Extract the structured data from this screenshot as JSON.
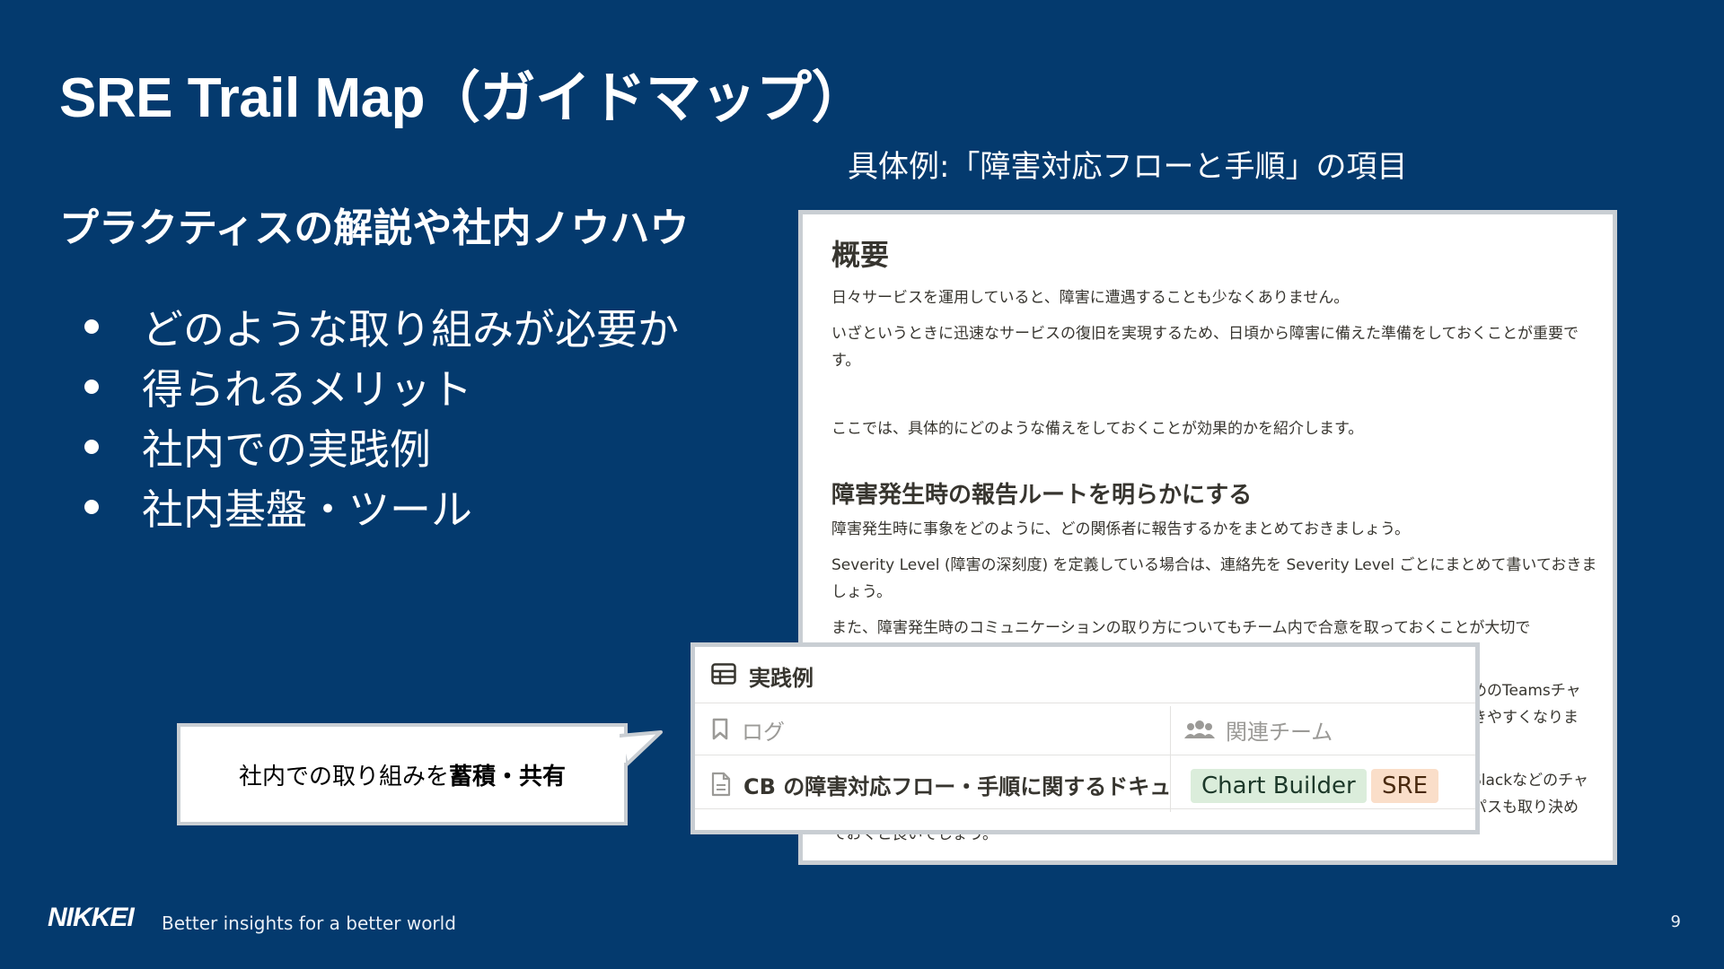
{
  "slide": {
    "title": "SRE Trail Map（ガイドマップ）",
    "subtitle": "プラクティスの解説や社内ノウハウ",
    "bullets": [
      "どのような取り組みが必要か",
      "得られるメリット",
      "社内での実践例",
      "社内基盤・ツール"
    ],
    "example_caption": "具体例:「障害対応フローと手順」の項目"
  },
  "doc": {
    "heading": "概要",
    "para1": "日々サービスを運用していると、障害に遭遇することも少なくありません。",
    "para2": "いざというときに迅速なサービスの復旧を実現するため、日頃から障害に備えた準備をしておくことが重要です。",
    "para3": "ここでは、具体的にどのような備えをしておくことが効果的かを紹介します。",
    "section_heading": "障害発生時の報告ルートを明らかにする",
    "para4": "障害発生時に事象をどのように、どの関係者に報告するかをまとめておきましょう。",
    "para5": "Severity Level (障害の深刻度) を定義している場合は、連絡先を Severity Level ごとにまとめて書いておきましょう。",
    "para6": "また、障害発生時のコミュニケーションの取り方についてもチーム内で合意を取っておくことが大切で",
    "frag1": "めのTeamsチャ",
    "frag2": "きやすくなりま",
    "frag3": "Slackなどのチャ",
    "frag4": "パスも取り決め",
    "frag5": "ておくと良いでしょう。"
  },
  "database": {
    "title": "実践例",
    "col_log": "ログ",
    "col_team": "関連チーム",
    "row_title": "CB の障害対応フロー・手順に関するドキュメント",
    "tags": [
      {
        "label": "Chart Builder",
        "bg": "#dbeddb",
        "fg": "#1c3829"
      },
      {
        "label": "SRE",
        "bg": "#fadec9",
        "fg": "#49290e"
      }
    ]
  },
  "callout": {
    "prefix": "社内での取り組みを ",
    "emphasis": "蓄積・共有"
  },
  "footer": {
    "logo": "NIKKEI",
    "tagline": "Better insights for a better world",
    "page_number": "9"
  },
  "colors": {
    "background": "#043a6e",
    "text": "#ffffff",
    "doc_text": "#37352f"
  }
}
